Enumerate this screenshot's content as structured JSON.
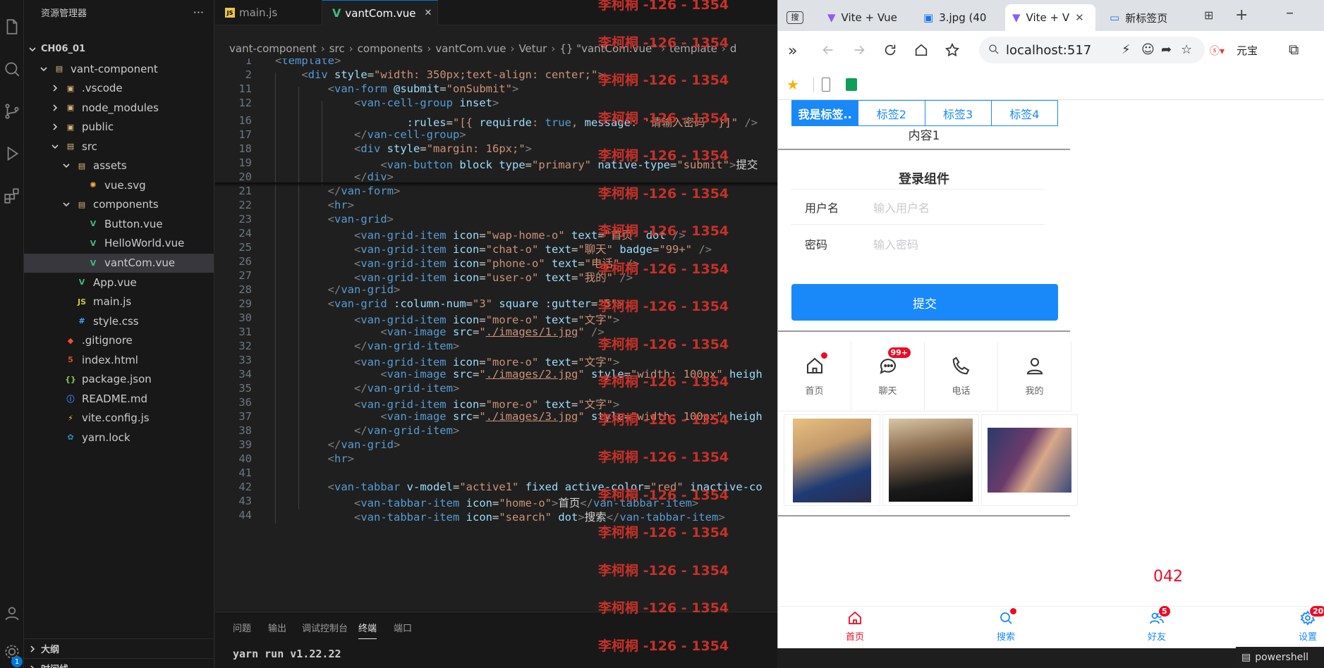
{
  "explorer": {
    "title": "资源管理器",
    "more": "···",
    "root": "CH06_01",
    "items": [
      {
        "label": "vant-component",
        "kind": "folder-open"
      },
      {
        "label": ".vscode",
        "kind": "folder"
      },
      {
        "label": "node_modules",
        "kind": "folder"
      },
      {
        "label": "public",
        "kind": "folder"
      },
      {
        "label": "src",
        "kind": "folder-open"
      },
      {
        "label": "assets",
        "kind": "folder-open"
      },
      {
        "label": "vue.svg",
        "kind": "svg"
      },
      {
        "label": "components",
        "kind": "folder-open"
      },
      {
        "label": "Button.vue",
        "kind": "vue"
      },
      {
        "label": "HelloWorld.vue",
        "kind": "vue"
      },
      {
        "label": "vantCom.vue",
        "kind": "vue"
      },
      {
        "label": "App.vue",
        "kind": "vue"
      },
      {
        "label": "main.js",
        "kind": "js"
      },
      {
        "label": "style.css",
        "kind": "css"
      },
      {
        "label": ".gitignore",
        "kind": "git"
      },
      {
        "label": "index.html",
        "kind": "html"
      },
      {
        "label": "package.json",
        "kind": "json"
      },
      {
        "label": "README.md",
        "kind": "info"
      },
      {
        "label": "vite.config.js",
        "kind": "vite"
      },
      {
        "label": "yarn.lock",
        "kind": "yarn"
      }
    ],
    "outline": "大纲",
    "timeline": "时间线",
    "notify_count": "1"
  },
  "editor": {
    "tabs": [
      {
        "label": "main.js"
      },
      {
        "label": "vantCom.vue"
      }
    ],
    "close": "✕",
    "breadcrumb": [
      "vant-component",
      "src",
      "components",
      "vantCom.vue",
      "Vetur",
      "{} \"vantCom.vue\"",
      "template",
      "d"
    ],
    "lines": [
      {
        "n": "1",
        "html": "<span class='pu'>&lt;</span><span class='tg'>template</span><span class='pu'>&gt;</span>"
      },
      {
        "n": "2",
        "html": "    <span class='pu'>&lt;</span><span class='tg'>div</span> <span class='at'>style</span>=<span class='st'>\"width: 350px;text-align: center;\"</span><span class='pu'>&gt;</span>"
      },
      {
        "n": "11",
        "html": "        <span class='pu'>&lt;</span><span class='tg'>van-form</span> <span class='at'>@submit</span>=<span class='st'>\"onSubmit\"</span><span class='pu'>&gt;</span>"
      },
      {
        "n": "12",
        "html": "            <span class='pu'>&lt;</span><span class='tg'>van-cell-group</span> <span class='at'>inset</span><span class='pu'>&gt;</span>"
      },
      {
        "n": "16",
        "html": "                    <span class='at'>:rules</span>=<span class='st'>\"[{ </span><span class='at'>requirde</span><span class='st'>: </span><span class='kw'>true</span><span class='st'>, </span><span class='at'>message</span><span class='st'>: '请输入密码' }]\"</span> <span class='pu'>/&gt;</span>"
      },
      {
        "n": "17",
        "html": "            <span class='pu'>&lt;/</span><span class='tg'>van-cell-group</span><span class='pu'>&gt;</span>"
      },
      {
        "n": "18",
        "html": "            <span class='pu'>&lt;</span><span class='tg'>div</span> <span class='at'>style</span>=<span class='st'>\"margin: 16px;\"</span><span class='pu'>&gt;</span>"
      },
      {
        "n": "19",
        "html": "                <span class='pu'>&lt;</span><span class='tg'>van-button</span> <span class='at'>block</span> <span class='at'>type</span>=<span class='st'>\"primary\"</span> <span class='at'>native-type</span>=<span class='st'>\"submit\"</span><span class='pu'>&gt;</span><span class='tx'>提交</span>"
      },
      {
        "n": "20",
        "html": "            <span class='pu'>&lt;/</span><span class='tg'>div</span><span class='pu'>&gt;</span>"
      },
      {
        "n": "21",
        "html": "        <span class='pu'>&lt;/</span><span class='tg'>van-form</span><span class='pu'>&gt;</span>"
      },
      {
        "n": "22",
        "html": "        <span class='pu'>&lt;</span><span class='tg'>hr</span><span class='pu'>&gt;</span>"
      },
      {
        "n": "23",
        "html": "        <span class='pu'>&lt;</span><span class='tg'>van-grid</span><span class='pu'>&gt;</span>"
      },
      {
        "n": "24",
        "html": "            <span class='pu'>&lt;</span><span class='tg'>van-grid-item</span> <span class='at'>icon</span>=<span class='st'>\"wap-home-o\"</span> <span class='at'>text</span>=<span class='st'>\"首页\"</span> <span class='at'>dot</span> <span class='pu'>/&gt;</span>"
      },
      {
        "n": "25",
        "html": "            <span class='pu'>&lt;</span><span class='tg'>van-grid-item</span> <span class='at'>icon</span>=<span class='st'>\"chat-o\"</span> <span class='at'>text</span>=<span class='st'>\"聊天\"</span> <span class='at'>badge</span>=<span class='st'>\"99+\"</span> <span class='pu'>/&gt;</span>"
      },
      {
        "n": "26",
        "html": "            <span class='pu'>&lt;</span><span class='tg'>van-grid-item</span> <span class='at'>icon</span>=<span class='st'>\"phone-o\"</span> <span class='at'>text</span>=<span class='st'>\"电话\"</span> <span class='pu'>/&gt;</span>"
      },
      {
        "n": "27",
        "html": "            <span class='pu'>&lt;</span><span class='tg'>van-grid-item</span> <span class='at'>icon</span>=<span class='st'>\"user-o\"</span> <span class='at'>text</span>=<span class='st'>\"我的\"</span> <span class='pu'>/&gt;</span>"
      },
      {
        "n": "28",
        "html": "        <span class='pu'>&lt;/</span><span class='tg'>van-grid</span><span class='pu'>&gt;</span>"
      },
      {
        "n": "29",
        "html": "        <span class='pu'>&lt;</span><span class='tg'>van-grid</span> <span class='at'>:column-num</span>=<span class='st'>\"3\"</span> <span class='at'>square</span> <span class='at'>:gutter</span>=<span class='st'>\"5\"</span><span class='pu'>&gt;</span>"
      },
      {
        "n": "30",
        "html": "            <span class='pu'>&lt;</span><span class='tg'>van-grid-item</span> <span class='at'>icon</span>=<span class='st'>\"more-o\"</span> <span class='at'>text</span>=<span class='st'>\"文字\"</span><span class='pu'>&gt;</span>"
      },
      {
        "n": "31",
        "html": "                <span class='pu'>&lt;</span><span class='tg'>van-image</span> <span class='at'>src</span>=<span class='st'>\"<span class='lk'>./images/1.jpg</span>\"</span> <span class='pu'>/&gt;</span>"
      },
      {
        "n": "32",
        "html": "            <span class='pu'>&lt;/</span><span class='tg'>van-grid-item</span><span class='pu'>&gt;</span>"
      },
      {
        "n": "33",
        "html": "            <span class='pu'>&lt;</span><span class='tg'>van-grid-item</span> <span class='at'>icon</span>=<span class='st'>\"more-o\"</span> <span class='at'>text</span>=<span class='st'>\"文字\"</span><span class='pu'>&gt;</span>"
      },
      {
        "n": "34",
        "html": "                <span class='pu'>&lt;</span><span class='tg'>van-image</span> <span class='at'>src</span>=<span class='st'>\"<span class='lk'>./images/2.jpg</span>\"</span> <span class='at'>style</span>=<span class='st'>\"width: 100px\"</span> <span class='at'>heigh</span>"
      },
      {
        "n": "35",
        "html": "            <span class='pu'>&lt;/</span><span class='tg'>van-grid-item</span><span class='pu'>&gt;</span>"
      },
      {
        "n": "36",
        "html": "            <span class='pu'>&lt;</span><span class='tg'>van-grid-item</span> <span class='at'>icon</span>=<span class='st'>\"more-o\"</span> <span class='at'>text</span>=<span class='st'>\"文字\"</span><span class='pu'>&gt;</span>"
      },
      {
        "n": "37",
        "html": "                <span class='pu'>&lt;</span><span class='tg'>van-image</span> <span class='at'>src</span>=<span class='st'>\"<span class='lk'>./images/3.jpg</span>\"</span> <span class='at'>style</span>=<span class='st'>\"width: 100px\"</span> <span class='at'>heigh</span>"
      },
      {
        "n": "38",
        "html": "            <span class='pu'>&lt;/</span><span class='tg'>van-grid-item</span><span class='pu'>&gt;</span>"
      },
      {
        "n": "39",
        "html": "        <span class='pu'>&lt;/</span><span class='tg'>van-grid</span><span class='pu'>&gt;</span>"
      },
      {
        "n": "40",
        "html": "        <span class='pu'>&lt;</span><span class='tg'>hr</span><span class='pu'>&gt;</span>"
      },
      {
        "n": "41",
        "html": ""
      },
      {
        "n": "42",
        "html": "        <span class='pu'>&lt;</span><span class='tg'>van-tabbar</span> <span class='at'>v-model</span>=<span class='st'>\"active1\"</span> <span class='at'>fixed</span> <span class='at'>active-color</span>=<span class='st'>\"red\"</span> <span class='at'>inactive-co</span>"
      },
      {
        "n": "43",
        "html": "            <span class='pu'>&lt;</span><span class='tg'>van-tabbar-item</span> <span class='at'>icon</span>=<span class='st'>\"home-o\"</span><span class='pu'>&gt;</span><span class='tx'>首页</span><span class='pu'>&lt;/</span><span class='tg'>van-tabbar-item</span><span class='pu'>&gt;</span>"
      },
      {
        "n": "44",
        "html": "            <span class='pu'>&lt;</span><span class='tg'>van-tabbar-item</span> <span class='at'>icon</span>=<span class='st'>\"search\"</span> <span class='at'>dot</span><span class='pu'>&gt;</span><span class='tx'>搜索</span><span class='pu'>&lt;/</span><span class='tg'>van-tabbar-item</span><span class='pu'>&gt;</span>"
      }
    ]
  },
  "panel": {
    "tabs": [
      "问题",
      "输出",
      "调试控制台",
      "终端",
      "端口"
    ],
    "active": "终端",
    "terminal_line": "yarn run v1.22.22"
  },
  "watermark": "李柯桐 -126 - 1354",
  "browser": {
    "tabs": [
      {
        "label": "Vite + Vue"
      },
      {
        "label": "3.jpg (40"
      },
      {
        "label": "Vite + V"
      },
      {
        "label": "新标签页"
      }
    ],
    "address": "localhost:517",
    "extension_label": "元宝",
    "page": {
      "tabs": [
        "我是标签..",
        "标签2",
        "标签3",
        "标签4"
      ],
      "content": "内容1",
      "form_title": "登录组件",
      "username_label": "用户名",
      "username_placeholder": "输入用户名",
      "password_label": "密码",
      "password_placeholder": "输入密码",
      "submit": "提交",
      "grid": [
        {
          "text": "首页",
          "icon": "home-icon"
        },
        {
          "text": "聊天",
          "icon": "chat-icon",
          "badge": "99+"
        },
        {
          "text": "电话",
          "icon": "phone-icon"
        },
        {
          "text": "我的",
          "icon": "user-icon"
        }
      ],
      "number": "042",
      "tabbar": [
        {
          "text": "首页",
          "icon": "home-icon"
        },
        {
          "text": "搜索",
          "icon": "search-icon"
        },
        {
          "text": "好友",
          "icon": "friends-icon",
          "badge": "5"
        },
        {
          "text": "设置",
          "icon": "settings-icon",
          "badge": "20"
        }
      ]
    },
    "taskbar_text": "powershell"
  },
  "colors": {
    "vant_blue": "#1989fa",
    "badge_red": "#ee0a24",
    "active_red": "#ee0a24",
    "inactive_blue": "#1989fa",
    "watermark": "#d9342b"
  }
}
